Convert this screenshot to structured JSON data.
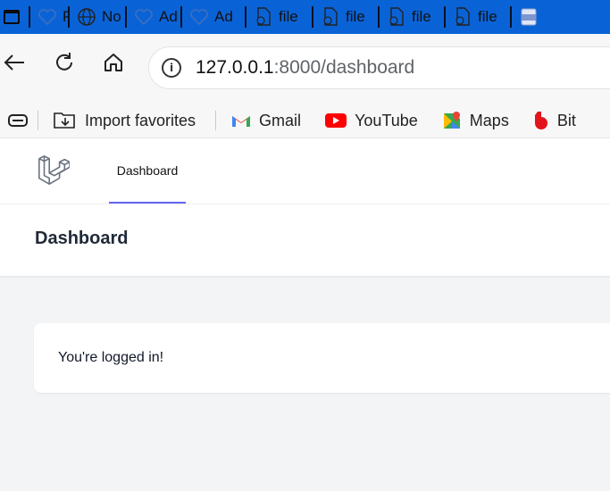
{
  "browser": {
    "tabs": [
      {
        "label": "Pro",
        "icon": "heart-icon"
      },
      {
        "label": "No",
        "icon": "globe-icon"
      },
      {
        "label": "Ad",
        "icon": "heart-icon"
      },
      {
        "label": "Ad",
        "icon": "heart-icon"
      },
      {
        "label": "file",
        "icon": "file-icon"
      },
      {
        "label": "file",
        "icon": "file-icon"
      },
      {
        "label": "file",
        "icon": "file-icon"
      },
      {
        "label": "file",
        "icon": "file-icon"
      },
      {
        "label": "",
        "icon": "pdf-icon"
      }
    ],
    "address": {
      "host": "127.0.0.1",
      "path": ":8000/dashboard"
    },
    "favorites": [
      {
        "label": "Import favorites",
        "icon": "import-favorites-icon"
      },
      {
        "label": "Gmail",
        "icon": "gmail-icon"
      },
      {
        "label": "YouTube",
        "icon": "youtube-icon"
      },
      {
        "label": "Maps",
        "icon": "maps-icon"
      },
      {
        "label": "Bit",
        "icon": "bit-icon"
      }
    ],
    "colors": {
      "tabstrip": "#0a63d6"
    }
  },
  "app": {
    "nav": {
      "dashboard_label": "Dashboard"
    },
    "header": {
      "title": "Dashboard"
    },
    "card": {
      "message": "You're logged in!"
    },
    "colors": {
      "active_underline": "#6366f1"
    }
  }
}
